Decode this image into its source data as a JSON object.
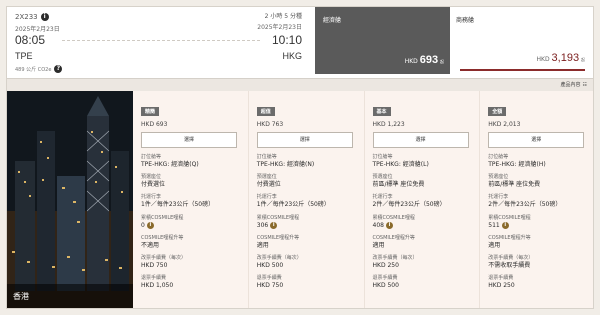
{
  "flight": {
    "code": "2X233",
    "duration": "2 小時 5 分種",
    "dep_date": "2025年2月23日",
    "arr_date": "2025年2月23日",
    "dep_time": "08:05",
    "arr_time": "10:10",
    "dep_airport": "TPE",
    "arr_airport": "HKG",
    "co2": "489 公斤 CO2e"
  },
  "cabins": {
    "economy": {
      "name": "經濟艙",
      "currency": "HKD",
      "price": "693",
      "suffix": "起"
    },
    "business": {
      "name": "商務艙",
      "currency": "HKD",
      "price": "3,193",
      "suffix": "起"
    }
  },
  "compare_label": "產品內容",
  "destination": {
    "label": "香港"
  },
  "select_label": "選擇",
  "row_labels": {
    "booking_class": "訂位艙等",
    "seat": "預選座位",
    "baggage": "托運行李",
    "miles": "累積COSMILE哩程",
    "upgrade": "COSMILE哩程升等",
    "change_fee": "改票手續費（每次）",
    "refund_fee": "退票手續費"
  },
  "fares": [
    {
      "tag": "精簡",
      "price": "HKD 693",
      "booking_class": "TPE-HKG: 經濟艙(Q)",
      "seat": "付費選位",
      "baggage": "1件／每件23公斤（50磅）",
      "miles": "0",
      "upgrade": "不適用",
      "change_fee": "HKD 750",
      "refund_fee": "HKD 1,050"
    },
    {
      "tag": "超值",
      "price": "HKD 763",
      "booking_class": "TPE-HKG: 經濟艙(N)",
      "seat": "付費選位",
      "baggage": "1件／每件23公斤（50磅）",
      "miles": "306",
      "upgrade": "適用",
      "change_fee": "HKD 500",
      "refund_fee": "HKD 750"
    },
    {
      "tag": "基本",
      "price": "HKD 1,223",
      "booking_class": "TPE-HKG: 經濟艙(L)",
      "seat": "前區/標準 座位免費",
      "baggage": "2件／每件23公斤（50磅）",
      "miles": "408",
      "upgrade": "適用",
      "change_fee": "HKD 250",
      "refund_fee": "HKD 500"
    },
    {
      "tag": "全額",
      "price": "HKD 2,013",
      "booking_class": "TPE-HKG: 經濟艙(H)",
      "seat": "前區/標準 座位免費",
      "baggage": "2件／每件23公斤（50磅）",
      "miles": "511",
      "upgrade": "適用",
      "change_fee": "不需收取手續費",
      "refund_fee": "HKD 250"
    }
  ],
  "colors": {
    "economy_bg": "#5a5a5a",
    "business_accent": "#8b2b2b",
    "fare_bg": "#fbf3ee",
    "tag_bg": "#6b6b6b"
  }
}
